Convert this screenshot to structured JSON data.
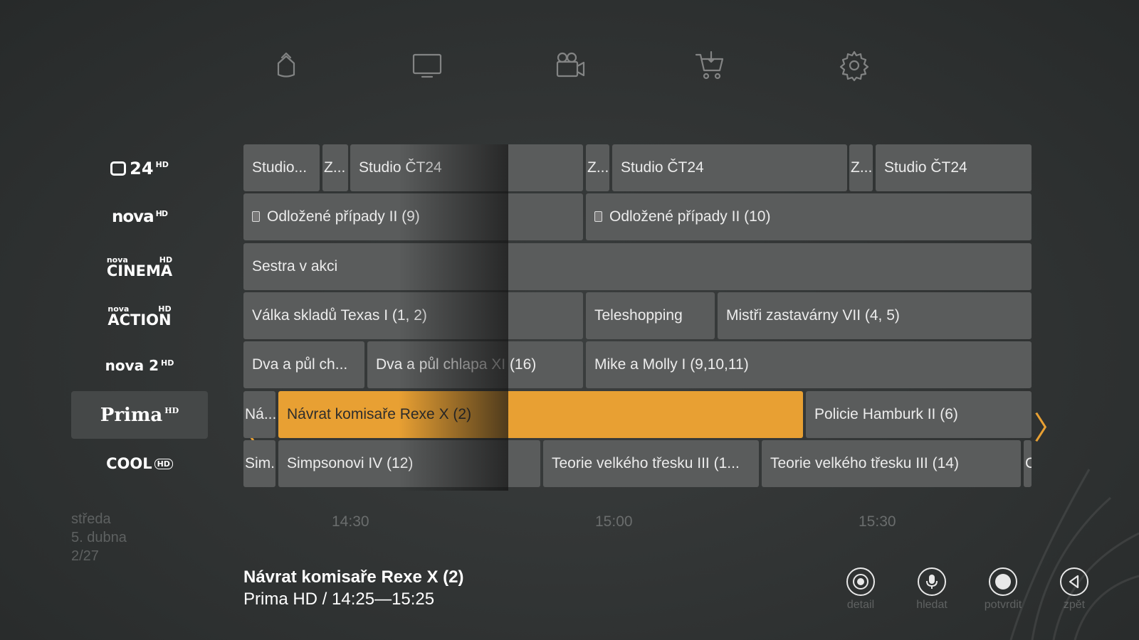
{
  "nav": [
    {
      "name": "home",
      "icon": "home-icon"
    },
    {
      "name": "tv",
      "icon": "tv-icon"
    },
    {
      "name": "video",
      "icon": "video-camera-icon"
    },
    {
      "name": "shop",
      "icon": "cart-icon"
    },
    {
      "name": "settings",
      "icon": "gear-icon"
    }
  ],
  "channels": [
    {
      "logo": "24",
      "hd": "HD"
    },
    {
      "logo": "nova",
      "hd": "HD"
    },
    {
      "logo_top": "nova",
      "logo": "CINEMA",
      "hd": "HD"
    },
    {
      "logo_top": "nova",
      "logo": "ACTION",
      "hd": "HD"
    },
    {
      "logo": "nova 2",
      "hd": "HD"
    },
    {
      "logo": "Prima",
      "hd": "HD"
    },
    {
      "logo": "COOL",
      "hd": "HD"
    }
  ],
  "programs": {
    "r0": [
      "Studio...",
      "Z...",
      "Studio ČT24",
      "",
      "Z...",
      "Studio ČT24",
      "Z...",
      "Studio ČT24"
    ],
    "r1": [
      "Odložené případy II (9)",
      "",
      "Odložené případy II (10)"
    ],
    "r2": [
      "Sestra v akci",
      ""
    ],
    "r3": [
      "Válka skladů Texas I (1, 2)",
      "",
      "Teleshopping",
      "Mistři zastavárny VII (4, 5)"
    ],
    "r4": [
      "Dva a půl ch...",
      "Dva a půl chlapa XI (16)",
      "Mike a Molly I (9,10,11)"
    ],
    "r5": [
      "Ná...",
      "Návrat komisaře Rexe X (2)",
      "Policie Hamburk II (6)"
    ],
    "r6": [
      "Sim...",
      "Simpsonovi IV (12)",
      "",
      "Teorie velkého třesku III (1...",
      "Teorie velkého třesku III (14)",
      "C"
    ]
  },
  "times": [
    "14:30",
    "15:00",
    "15:30"
  ],
  "date": {
    "day": "středa",
    "date": "5. dubna",
    "page": "2/27"
  },
  "info": {
    "title": "Návrat komisaře Rexe X (2)",
    "subtitle": "Prima HD / 14:25—15:25"
  },
  "controls": [
    {
      "label": "detail",
      "icon": "detail-icon"
    },
    {
      "label": "hledat",
      "icon": "microphone-icon"
    },
    {
      "label": "potvrdit",
      "icon": "confirm-icon"
    },
    {
      "label": "zpět",
      "icon": "back-icon"
    }
  ],
  "arrows": {
    "left": "〈",
    "right": "〉"
  },
  "colors": {
    "highlight": "#e8a033",
    "cell": "#5a5c5c",
    "background": "#333636"
  }
}
